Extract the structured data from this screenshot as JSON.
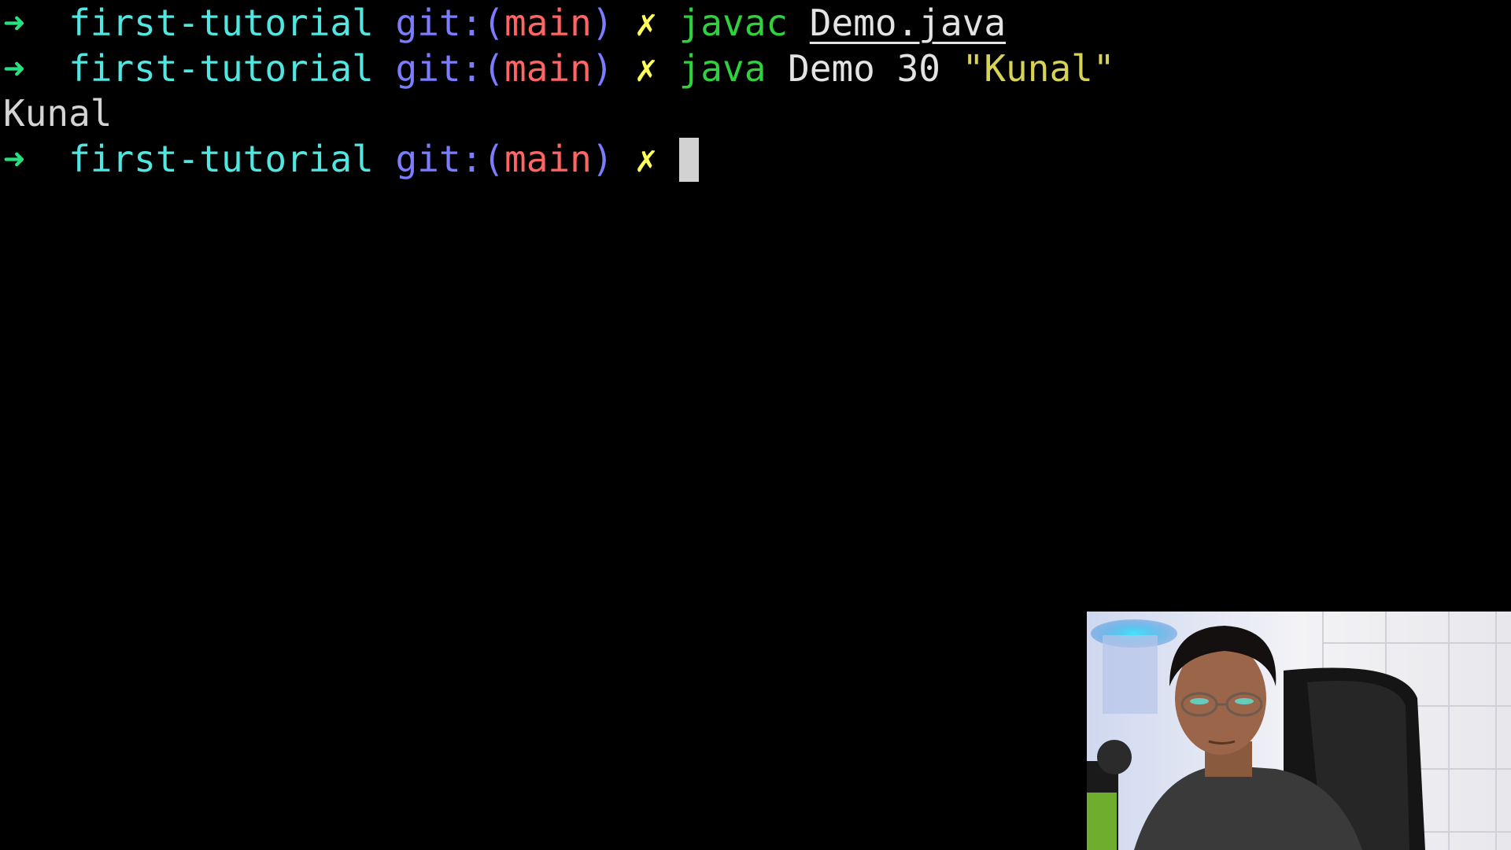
{
  "terminal": {
    "prompt": {
      "arrow": "➜",
      "directory": "first-tutorial",
      "git_label": "git:(",
      "branch": "main",
      "git_close": ")",
      "dirty_marker": "✗"
    },
    "lines": [
      {
        "command": "javac",
        "arg": "Demo.java"
      },
      {
        "command": "java",
        "args": "Demo 30",
        "string_arg": "\"Kunal\""
      }
    ],
    "output": "Kunal"
  },
  "colors": {
    "background": "#000000",
    "arrow": "#27e07f",
    "directory": "#52e6e0",
    "git": "#7c7cff",
    "branch": "#ff6565",
    "dirty": "#ffff5c",
    "command": "#2fd13e",
    "string": "#d7d356"
  },
  "webcam": {
    "icon": "presenter-webcam"
  }
}
